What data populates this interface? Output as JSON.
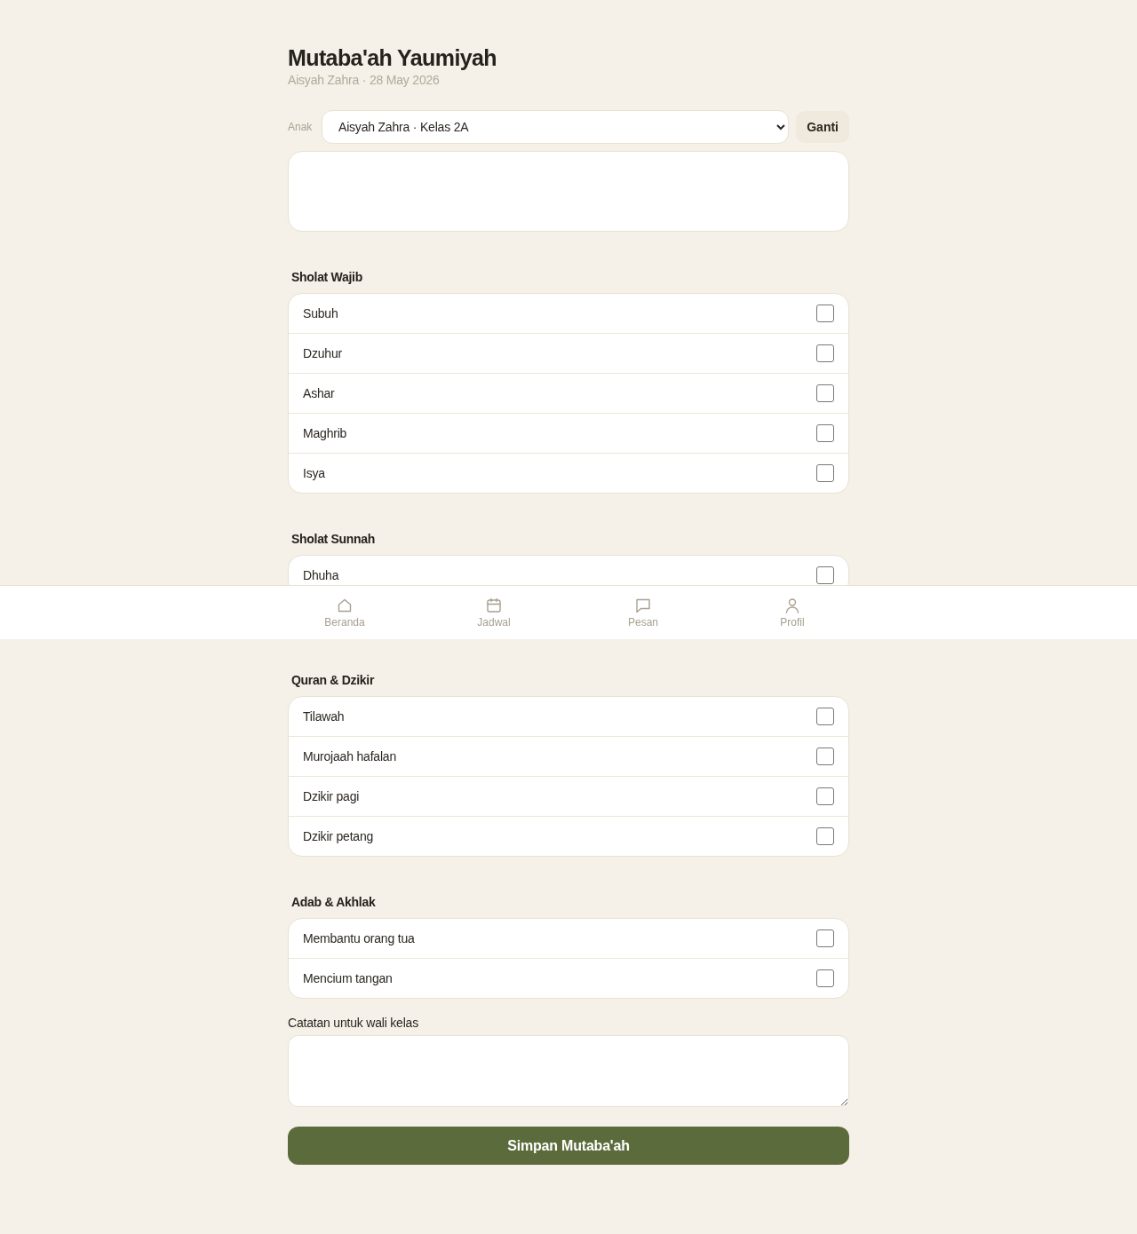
{
  "header": {
    "title": "Mutaba'ah Yaumiyah",
    "subtitle": "Aisyah Zahra · 28 May 2026"
  },
  "child_picker": {
    "label": "Anak",
    "value": "Aisyah Zahra · Kelas 2A",
    "button": "Ganti"
  },
  "sections": [
    {
      "title": "Sholat Wajib",
      "items": [
        {
          "label": "Subuh",
          "checked": false
        },
        {
          "label": "Dzuhur",
          "checked": false
        },
        {
          "label": "Ashar",
          "checked": false
        },
        {
          "label": "Maghrib",
          "checked": false
        },
        {
          "label": "Isya",
          "checked": false
        }
      ]
    },
    {
      "title": "Sholat Sunnah",
      "items": [
        {
          "label": "Dhuha",
          "checked": false
        }
      ]
    },
    {
      "title": "Quran & Dzikir",
      "items": [
        {
          "label": "Tilawah",
          "checked": false
        },
        {
          "label": "Murojaah hafalan",
          "checked": false
        },
        {
          "label": "Dzikir pagi",
          "checked": false
        },
        {
          "label": "Dzikir petang",
          "checked": false
        }
      ]
    },
    {
      "title": "Adab & Akhlak",
      "items": [
        {
          "label": "Membantu orang tua",
          "checked": false
        },
        {
          "label": "Mencium tangan",
          "checked": false
        }
      ]
    }
  ],
  "notes": {
    "label": "Catatan untuk wali kelas"
  },
  "submit": {
    "label": "Simpan Mutaba'ah"
  },
  "bottom_nav": [
    {
      "label": "Beranda",
      "selected": false
    },
    {
      "label": "Jadwal",
      "selected": false
    },
    {
      "label": "Pesan",
      "selected": false
    },
    {
      "label": "Profil",
      "selected": false
    }
  ]
}
